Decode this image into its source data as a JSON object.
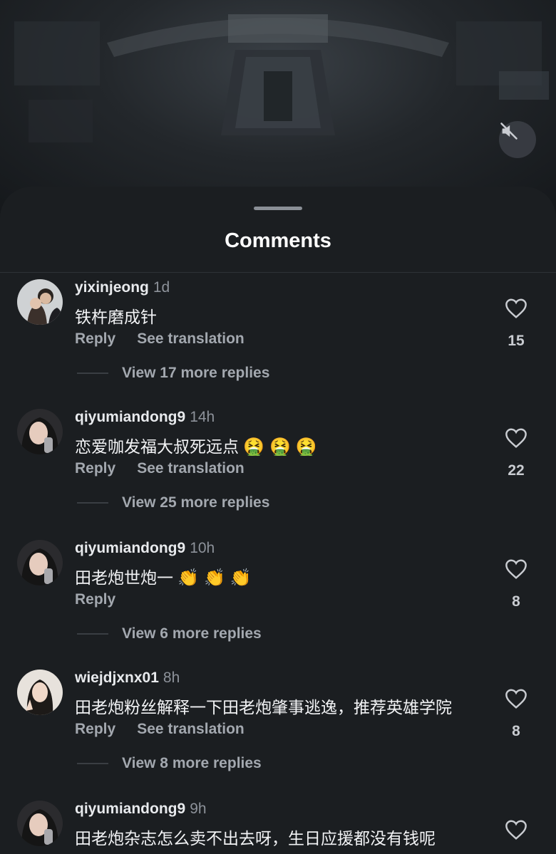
{
  "sheet": {
    "title": "Comments"
  },
  "comments": [
    {
      "username": "yixinjeong",
      "time": "1d",
      "text": "铁杵磨成针",
      "reply": "Reply",
      "translate": "See translation",
      "likes": "15",
      "view_replies": "View 17 more replies"
    },
    {
      "username": "qiyumiandong9",
      "time": "14h",
      "text": "恋爱咖发福大叔死远点",
      "emojis": "🤮 🤮 🤮",
      "reply": "Reply",
      "translate": "See translation",
      "likes": "22",
      "view_replies": "View 25 more replies"
    },
    {
      "username": "qiyumiandong9",
      "time": "10h",
      "text": "田老炮世炮一",
      "emojis": "👏 👏 👏",
      "reply": "Reply",
      "likes": "8",
      "view_replies": "View 6 more replies"
    },
    {
      "username": "wiejdjxnx01",
      "time": "8h",
      "text": "田老炮粉丝解释一下田老炮肇事逃逸，推荐英雄学院",
      "reply": "Reply",
      "translate": "See translation",
      "likes": "8",
      "view_replies": "View 8 more replies"
    },
    {
      "username": "qiyumiandong9",
      "time": "9h",
      "text": "田老炮杂志怎么卖不出去呀，生日应援都没有钱呢"
    }
  ],
  "icons": {
    "mute": "speaker-muted-icon",
    "like": "heart-outline-icon"
  },
  "colors": {
    "background": "#1b1e21",
    "secondary_text": "#a3a8af"
  }
}
